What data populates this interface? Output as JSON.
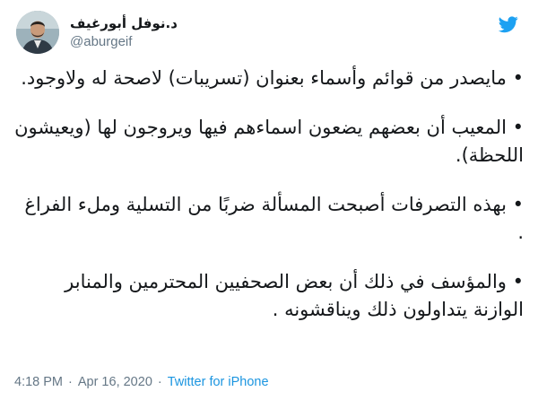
{
  "author": {
    "display_name": "د.نوفل أبورغيف",
    "handle": "@aburgeif"
  },
  "icons": {
    "avatar": "profile-photo",
    "brand": "twitter-bird-icon"
  },
  "colors": {
    "brand": "#1da1f2",
    "link": "#1b95e0",
    "muted": "#657786",
    "text": "#14171a"
  },
  "tweet": {
    "paragraphs": [
      "• مايصدر من قوائم وأسماء بعنوان (تسريبات) لاصحة له ولاوجود.",
      "• المعيب أن بعضهم يضعون اسماءهم فيها ويروجون لها (ويعيشون اللحظة).",
      "• بهذه التصرفات أصبحت المسألة ضربًا من التسلية وملء الفراغ .",
      "• والمؤسف في ذلك أن بعض الصحفيين المحترمين والمنابر الوازنة يتداولون ذلك ويناقشونه ."
    ]
  },
  "meta": {
    "time": "4:18 PM",
    "separator": "·",
    "date": "Apr 16, 2020",
    "source": "Twitter for iPhone"
  }
}
